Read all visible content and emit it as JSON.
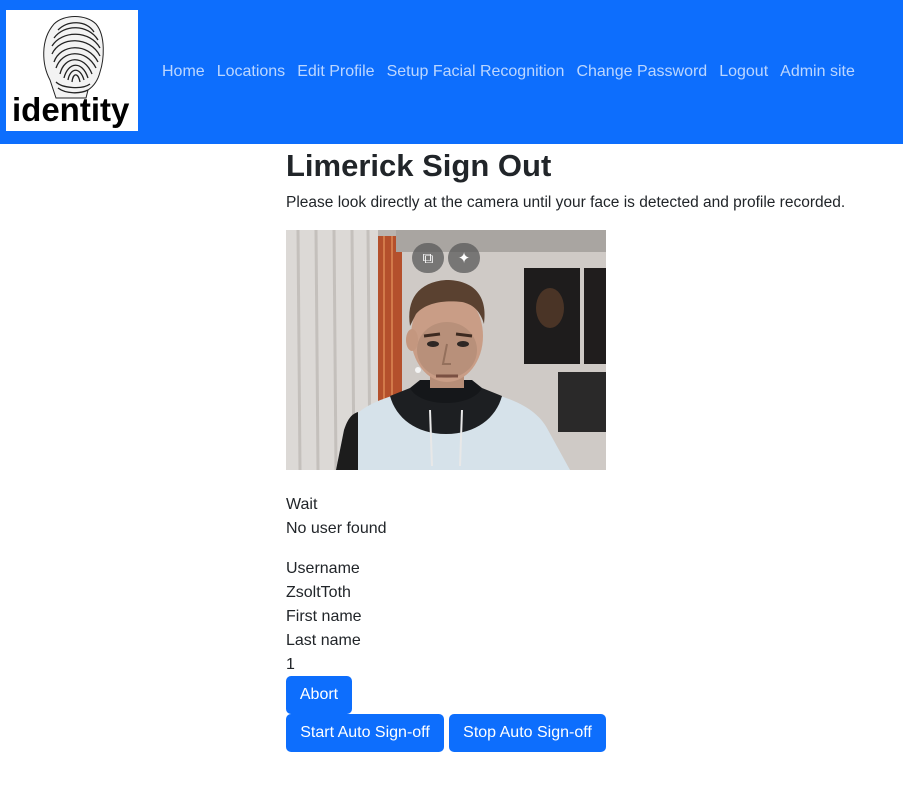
{
  "logo": {
    "text": "identity"
  },
  "nav": {
    "links": [
      "Home",
      "Locations",
      "Edit Profile",
      "Setup Facial Recognition",
      "Change Password",
      "Logout",
      "Admin site"
    ]
  },
  "page": {
    "title": "Limerick Sign Out",
    "instruction": "Please look directly at the camera until your face is detected and profile recorded."
  },
  "video": {
    "overlay_buttons": [
      {
        "icon": "picture-in-picture-icon",
        "glyph": "⧉"
      },
      {
        "icon": "sparkle-icon",
        "glyph": "✦"
      }
    ]
  },
  "status": {
    "state": "Wait",
    "message": "No user found"
  },
  "profile": {
    "username_label": "Username",
    "username_value": "ZsoltToth",
    "first_name_label": "First name",
    "last_name_label": "Last name",
    "counter": "1"
  },
  "actions": {
    "abort": "Abort",
    "start_auto": "Start Auto Sign-off",
    "stop_auto": "Stop Auto Sign-off"
  },
  "colors": {
    "primary": "#0d6efd",
    "text": "#212529"
  }
}
